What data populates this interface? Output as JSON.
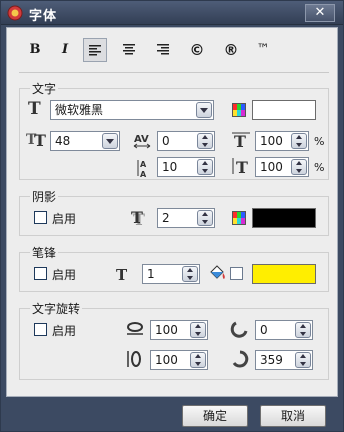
{
  "window": {
    "title": "字体",
    "close_glyph": "✕"
  },
  "toolbar": {
    "bold": "B",
    "italic": "I",
    "copyright": "©",
    "registered": "®",
    "trademark": "™"
  },
  "text_group": {
    "label": "文字",
    "font_family": "微软雅黑",
    "font_size": "48",
    "char_spacing": "0",
    "line_spacing": "10",
    "width_scale": "100",
    "height_scale": "100",
    "percent": "%",
    "bg_color": "#ffffff"
  },
  "shadow_group": {
    "label": "阴影",
    "enable_label": "启用",
    "distance": "2",
    "color": "#000000"
  },
  "stroke_group": {
    "label": "笔锋",
    "enable_label": "启用",
    "width": "1",
    "color": "#ffee00"
  },
  "rotate_group": {
    "label": "文字旋转",
    "enable_label": "启用",
    "width": "100",
    "height": "100",
    "start_angle": "0",
    "end_angle": "359"
  },
  "buttons": {
    "ok": "确定",
    "cancel": "取消"
  },
  "icons": [
    "app-icon",
    "close-icon",
    "bold-icon",
    "italic-icon",
    "align-left-icon",
    "align-center-icon",
    "align-right-icon",
    "copyright-icon",
    "registered-icon",
    "trademark-icon",
    "font-icon",
    "font-size-icon",
    "char-spacing-icon",
    "line-spacing-icon",
    "width-scale-icon",
    "height-scale-icon",
    "color-palette-icon",
    "shadow-icon",
    "stroke-icon",
    "paint-bucket-icon",
    "rotate-width-icon",
    "rotate-height-icon",
    "start-angle-icon",
    "end-angle-icon"
  ]
}
